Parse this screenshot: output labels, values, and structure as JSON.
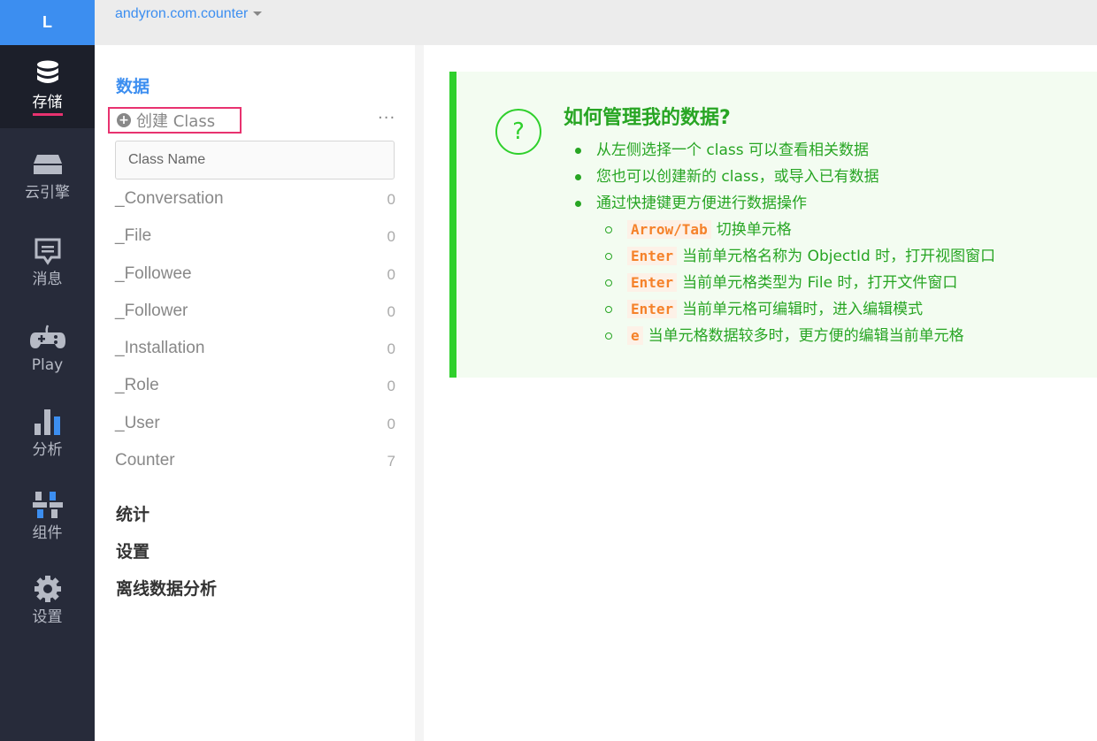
{
  "brand": {
    "logo": "L"
  },
  "nav": [
    {
      "label": "存储",
      "icon": "database-icon",
      "active": true
    },
    {
      "label": "云引擎",
      "icon": "server-icon",
      "active": false
    },
    {
      "label": "消息",
      "icon": "message-icon",
      "active": false
    },
    {
      "label": "Play",
      "icon": "gamepad-icon",
      "active": false
    },
    {
      "label": "分析",
      "icon": "bar-chart-icon",
      "active": false
    },
    {
      "label": "组件",
      "icon": "components-icon",
      "active": false
    },
    {
      "label": "设置",
      "icon": "gear-icon",
      "active": false
    }
  ],
  "topbar": {
    "app_name": "andyron.com.counter"
  },
  "sidebar": {
    "data_title": "数据",
    "create_class_label": "创建 Class",
    "more_label": "···",
    "class_name_placeholder": "Class Name",
    "classes": [
      {
        "name": "_Conversation",
        "count": "0"
      },
      {
        "name": "_File",
        "count": "0"
      },
      {
        "name": "_Followee",
        "count": "0"
      },
      {
        "name": "_Follower",
        "count": "0"
      },
      {
        "name": "_Installation",
        "count": "0"
      },
      {
        "name": "_Role",
        "count": "0"
      },
      {
        "name": "_User",
        "count": "0"
      },
      {
        "name": "Counter",
        "count": "7"
      }
    ],
    "sections": [
      "统计",
      "设置",
      "离线数据分析"
    ]
  },
  "help": {
    "icon_glyph": "?",
    "title": "如何管理我的数据?",
    "bullets": [
      "从左侧选择一个 class 可以查看相关数据",
      "您也可以创建新的 class，或导入已有数据",
      "通过快捷键更方便进行数据操作"
    ],
    "shortcuts": [
      {
        "key": "Arrow/Tab",
        "desc": "切换单元格"
      },
      {
        "key": "Enter",
        "desc": "当前单元格名称为 ObjectId 时，打开视图窗口"
      },
      {
        "key": "Enter",
        "desc": "当前单元格类型为 File 时，打开文件窗口"
      },
      {
        "key": "Enter",
        "desc": "当前单元格可编辑时，进入编辑模式"
      },
      {
        "key": "e",
        "desc": "当单元格数据较多时，更方便的编辑当前单元格"
      }
    ]
  },
  "colors": {
    "accent": "#3c8ef0",
    "rail": "#272b3a",
    "highlight": "#e8326f",
    "success": "#27a523"
  }
}
